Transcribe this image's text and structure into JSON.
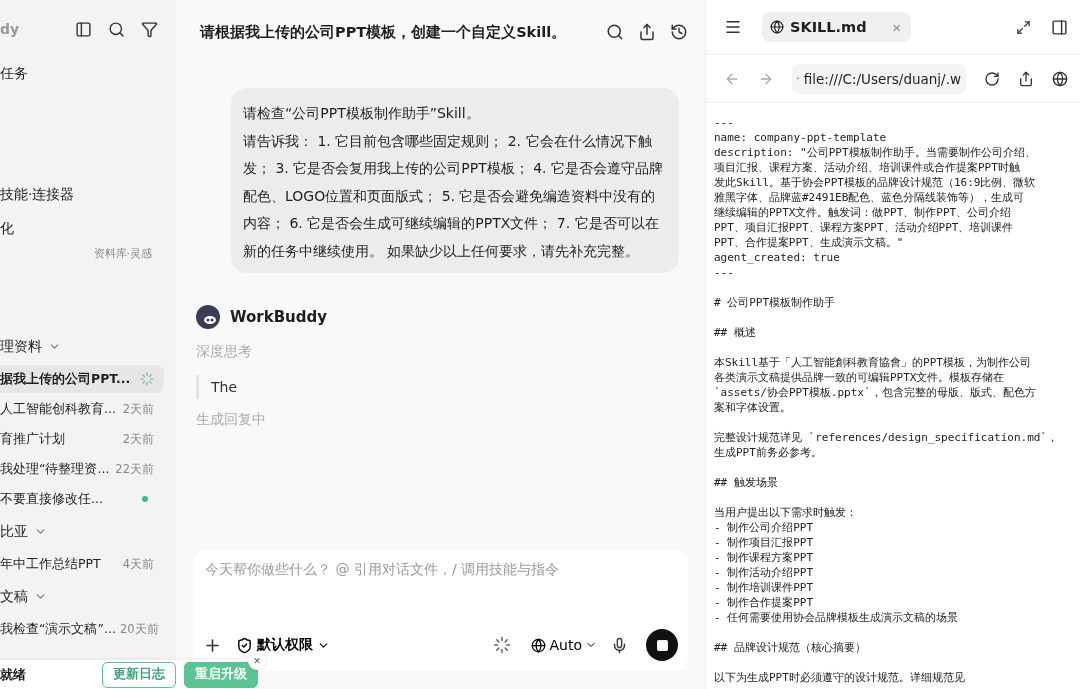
{
  "sidebar": {
    "brand": "dy",
    "nav": [
      {
        "label": "任务"
      },
      {
        "label": "技能·连接器"
      },
      {
        "label": "化"
      }
    ],
    "library_label": "资料库·灵感",
    "groups": [
      {
        "title": "理资料",
        "expanded": true,
        "items": [
          {
            "title": "据我上传的公司PPT...",
            "selected": true,
            "running": true,
            "unread": false
          },
          {
            "title": "人工智能创科教育...",
            "selected": false,
            "time": "2天前",
            "running": false,
            "unread": false
          },
          {
            "title": "育推广计划",
            "selected": false,
            "time": "2天前",
            "running": false,
            "unread": false
          },
          {
            "title": "我处理“待整理资...",
            "selected": false,
            "time": "22天前",
            "running": false,
            "unread": false
          },
          {
            "title": "不要直接修改任...",
            "selected": false,
            "running": false,
            "unread": true
          }
        ]
      },
      {
        "title": "比亚",
        "expanded": true,
        "items": [
          {
            "title": "年中工作总结PPT",
            "selected": false,
            "time": "4天前",
            "running": false,
            "unread": false
          }
        ]
      },
      {
        "title": "文稿",
        "expanded": true,
        "items": [
          {
            "title": "我检查“演示文稿”...",
            "selected": false,
            "time": "20天前",
            "running": false,
            "unread": false
          }
        ]
      }
    ]
  },
  "toast": {
    "status": "就绪",
    "buttons": [
      {
        "label": "更新日志",
        "kind": "outline"
      },
      {
        "label": "重启升级",
        "kind": "primary"
      }
    ],
    "close": "×"
  },
  "chat": {
    "title": "请根据我上传的公司PPT模板，创建一个自定义Skill。",
    "user_message": [
      "请检查“公司PPT模板制作助手”Skill。",
      "请告诉我：  1. 它目前包含哪些固定规则；  2. 它会在什么情况下触发；  3. 它是否会复用我上传的公司PPT模板；  4. 它是否会遵守品牌配色、LOGO位置和页面版式；  5. 它是否会避免编造资料中没有的内容；  6. 它是否会生成可继续编辑的PPTX文件；  7. 它是否可以在新的任务中继续使用。  如果缺少以上任何要求，请先补充完整。"
    ],
    "assistant": {
      "name": "WorkBuddy",
      "thinking_label": "深度思考",
      "thinking_text": "The",
      "status": "生成回复中"
    },
    "composer": {
      "placeholder": "今天帮你做些什么？ @ 引用对话文件，/ 调用技能与指令",
      "permission": "默认权限",
      "model": "Auto",
      "busy": true
    }
  },
  "viewer": {
    "tab": {
      "label": "SKILL.md",
      "close": "×",
      "selected": true
    },
    "url": "file:///C:/Users/duanj/.w",
    "blocks": [
      [
        "---",
        "name: company-ppt-template",
        "description: \"公司PPT模板制作助手。当需要制作公司介绍、",
        "项目汇报、课程方案、活动介绍、培训课件或合作提案PPT时触",
        "发此Skill。基于协会PPT模板的品牌设计规范（16:9比例、微软",
        "雅黑字体、品牌蓝#2491EB配色、蓝色分隔线装饰等），生成可",
        "继续编辑的PPTX文件。触发词：做PPT、制作PPT、公司介绍",
        "PPT、项目汇报PPT、课程方案PPT、活动介绍PPT、培训课件",
        "PPT、合作提案PPT、生成演示文稿。\"",
        "agent_created: true",
        "---"
      ],
      [
        "# 公司PPT模板制作助手"
      ],
      [
        "## 概述"
      ],
      [
        "本Skill基于「人工智能創科教育協會」的PPT模板，为制作公司",
        "各类演示文稿提供品牌一致的可编辑PPTX文件。模板存储在",
        "`assets/协会PPT模板.pptx`，包含完整的母版、版式、配色方",
        "案和字体设置。"
      ],
      [
        "完整设计规范详见 `references/design_specification.md`，",
        "生成PPT前务必参考。"
      ],
      [
        "## 触发场景"
      ],
      [
        "当用户提出以下需求时触发：",
        "- 制作公司介绍PPT",
        "- 制作项目汇报PPT",
        "- 制作课程方案PPT",
        "- 制作活动介绍PPT",
        "- 制作培训课件PPT",
        "- 制作合作提案PPT",
        "- 任何需要使用协会品牌模板生成演示文稿的场景"
      ],
      [
        "## 品牌设计规范（核心摘要）"
      ],
      [
        "以下为生成PPT时必须遵守的设计规范。详细规范见"
      ]
    ]
  }
}
